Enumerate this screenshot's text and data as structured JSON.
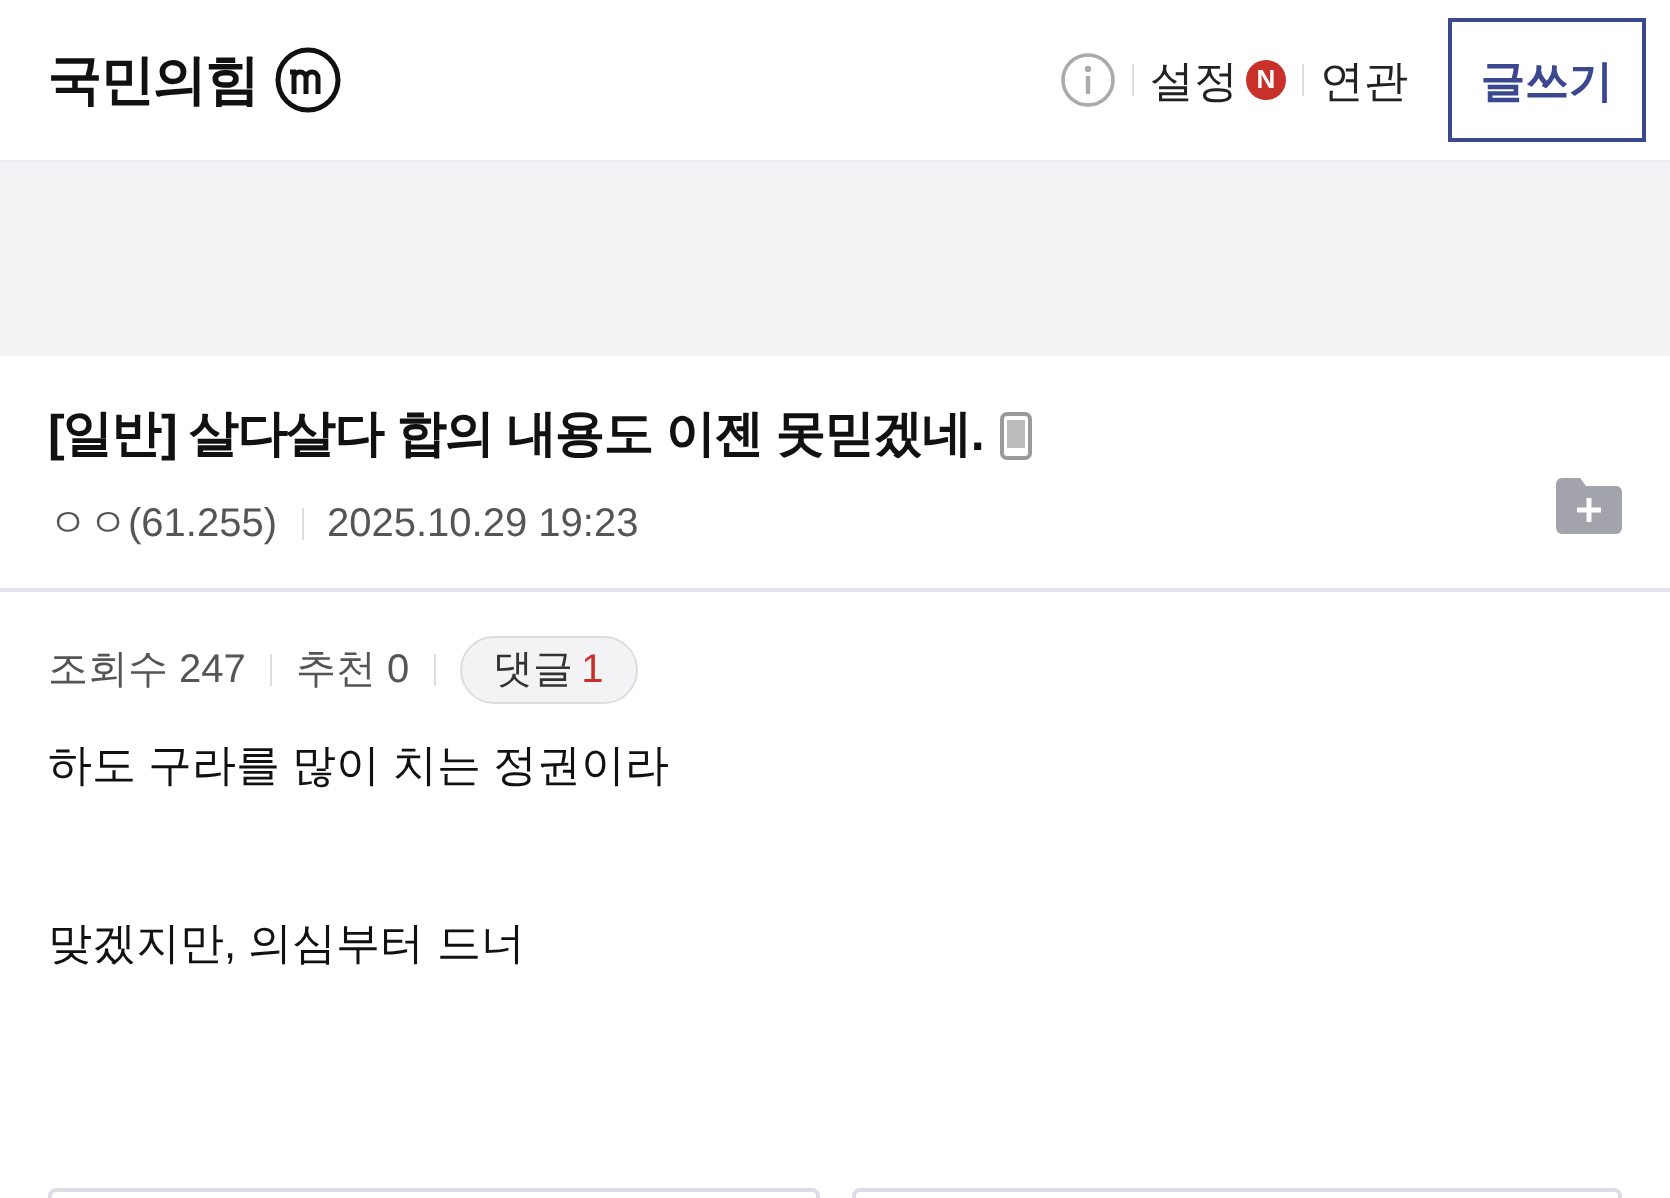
{
  "header": {
    "gallery_title": "국민의힘",
    "settings_label": "설정",
    "settings_badge": "N",
    "related_label": "연관",
    "write_button": "글쓰기"
  },
  "post": {
    "title": "[일반] 살다살다 합의 내용도 이젠 못믿겠네.",
    "author": "ㅇㅇ(61.255)",
    "date": "2025.10.29 19:23"
  },
  "stats": {
    "views": "조회수 247",
    "recommend": "추천 0",
    "comments_label": "댓글",
    "comments_count": "1"
  },
  "body": [
    "하도 구라를 많이 치는 정권이라",
    "맞겠지만, 의심부터 드너"
  ]
}
